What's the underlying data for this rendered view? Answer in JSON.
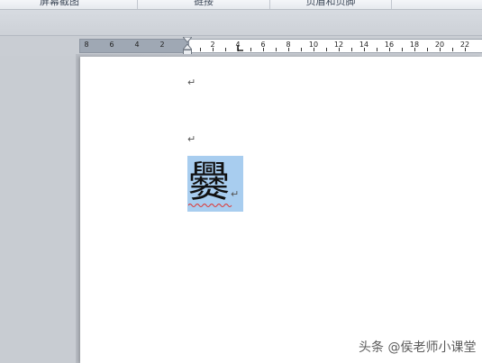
{
  "ribbon": {
    "groups": [
      {
        "label": "屏幕截图",
        "name": "screenshot"
      },
      {
        "label": "链接",
        "name": "links"
      },
      {
        "label": "页眉和页脚",
        "name": "header-footer"
      }
    ]
  },
  "ruler": {
    "numbers": [
      "8",
      "6",
      "4",
      "2",
      "2",
      "4",
      "6",
      "8",
      "10",
      "12",
      "14",
      "16",
      "18",
      "20",
      "22"
    ]
  },
  "document": {
    "paragraph_mark": "↵",
    "big_character": "爨",
    "selected": true
  },
  "watermark": "头条 @侯老师小课堂",
  "colors": {
    "selection": "#a8cdef",
    "spell_underline": "#e0312e",
    "app_background": "#c8ccd2"
  }
}
